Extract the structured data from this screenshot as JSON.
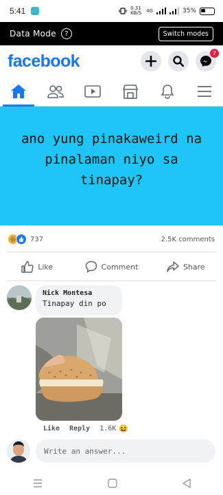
{
  "status_bar": {
    "time": "5:41",
    "data_speed": "0.31 KB/S",
    "network": "4G",
    "battery": "35%"
  },
  "data_mode": {
    "label": "Data Mode",
    "help_glyph": "?",
    "switch_label": "Switch modes"
  },
  "header": {
    "logo": "facebook",
    "messenger_badge": "7"
  },
  "nav": {
    "tabs": [
      "home-icon",
      "friends-icon",
      "watch-icon",
      "marketplace-icon",
      "notifications-icon",
      "menu-icon"
    ],
    "active": "home-icon"
  },
  "post": {
    "text": "ano yung pinakaweird na pinalaman niyo sa tinapay?",
    "background": "#1fc5f7"
  },
  "counts": {
    "reactions": "737",
    "comments": "2.5K comments"
  },
  "actions": {
    "like": "Like",
    "comment": "Comment",
    "share": "Share"
  },
  "comment": {
    "author": "Nick Montesa",
    "text": "Tinapay din po",
    "like_label": "Like",
    "reply_label": "Reply",
    "likes": "1.6K"
  },
  "answer": {
    "placeholder": "Write an answer..."
  },
  "colors": {
    "brand": "#1877f2",
    "post_bg": "#1fc5f7"
  }
}
